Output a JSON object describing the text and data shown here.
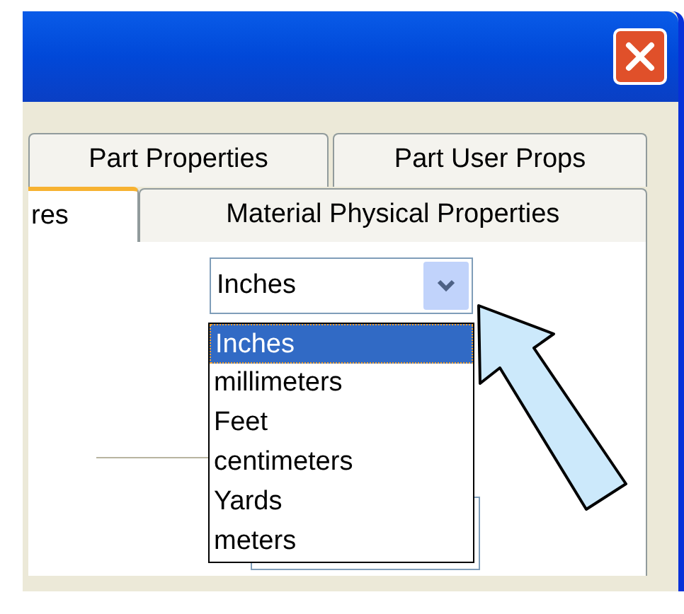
{
  "tab_rows": [
    {
      "tabs": [
        {
          "label": "Part Properties",
          "selected": false
        },
        {
          "label": "Part User Props",
          "selected": false
        }
      ]
    },
    {
      "tabs": [
        {
          "label": "res",
          "selected": true
        },
        {
          "label": "Material Physical Properties",
          "selected": false
        }
      ]
    }
  ],
  "units_dropdown": {
    "value": "Inches",
    "expanded": true,
    "options": [
      {
        "label": "Inches",
        "selected": true
      },
      {
        "label": "millimeters",
        "selected": false
      },
      {
        "label": "Feet",
        "selected": false
      },
      {
        "label": "centimeters",
        "selected": false
      },
      {
        "label": "Yards",
        "selected": false
      },
      {
        "label": "meters",
        "selected": false
      }
    ]
  }
}
